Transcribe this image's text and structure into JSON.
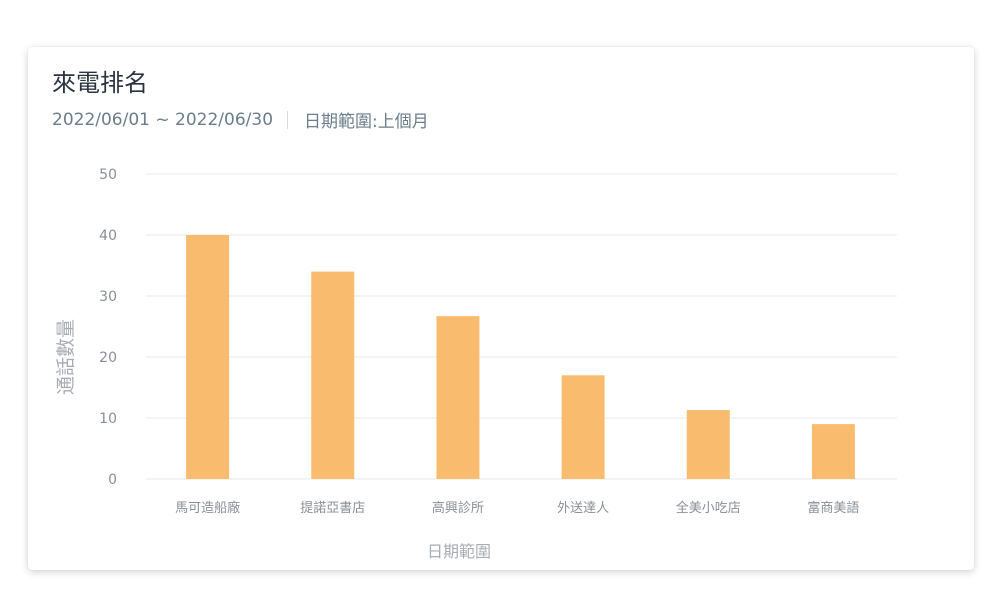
{
  "header": {
    "title": "來電排名",
    "date_range": "2022/06/01 ~ 2022/06/30",
    "range_label": "日期範圍:上個月"
  },
  "colors": {
    "bar": "#F9BC6E",
    "grid": "#e6e8eb",
    "tick_text": "#8a8f96",
    "axis_title": "#a8adb3"
  },
  "chart_data": {
    "type": "bar",
    "categories": [
      "馬可造船廠",
      "提諾亞書店",
      "高興診所",
      "外送達人",
      "全美小吃店",
      "富商美語"
    ],
    "values": [
      40,
      34,
      26.7,
      17,
      11.3,
      9
    ],
    "ylim": [
      0,
      50
    ],
    "yticks": [
      0,
      10,
      20,
      30,
      40,
      50
    ],
    "xlabel": "日期範圍",
    "ylabel": "通話數量",
    "grid": true,
    "legend": "none"
  }
}
